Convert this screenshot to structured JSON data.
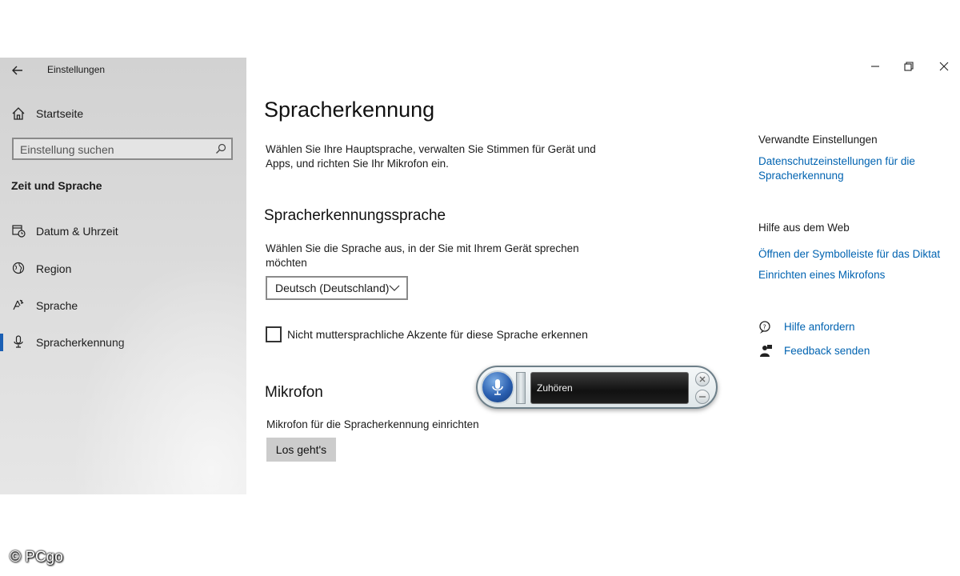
{
  "window": {
    "app_title": "Einstellungen"
  },
  "sidebar": {
    "home_label": "Startseite",
    "search_placeholder": "Einstellung suchen",
    "section_title": "Zeit und Sprache",
    "items": [
      {
        "label": "Datum & Uhrzeit",
        "icon": "calendar-clock-icon"
      },
      {
        "label": "Region",
        "icon": "globe-icon"
      },
      {
        "label": "Sprache",
        "icon": "language-icon"
      },
      {
        "label": "Spracherkennung",
        "icon": "microphone-icon",
        "active": true
      }
    ]
  },
  "main": {
    "page_title": "Spracherkennung",
    "intro": "Wählen Sie Ihre Hauptsprache, verwalten Sie Stimmen für Gerät und Apps, und richten Sie Ihr Mikrofon ein.",
    "language_section": {
      "title": "Spracherkennungssprache",
      "description": "Wählen Sie die Sprache aus, in der Sie mit Ihrem Gerät sprechen möchten",
      "selected_language": "Deutsch (Deutschland)",
      "accent_checkbox_label": "Nicht muttersprachliche Akzente für diese Sprache erkennen",
      "accent_checkbox_checked": false
    },
    "microphone_section": {
      "title": "Mikrofon",
      "description": "Mikrofon für die Spracherkennung einrichten",
      "button_label": "Los geht's"
    }
  },
  "related": {
    "title": "Verwandte Einstellungen",
    "privacy_link": "Datenschutzeinstellungen für die Spracherkennung",
    "web_help_title": "Hilfe aus dem Web",
    "dictation_link": "Öffnen der Symbolleiste für das Diktat",
    "mic_setup_link": "Einrichten eines Mikrofons",
    "get_help_link": "Hilfe anfordern",
    "feedback_link": "Feedback senden"
  },
  "speech_widget": {
    "status_text": "Zuhören"
  },
  "watermark": "© PCgo",
  "colors": {
    "link": "#0063b1",
    "accent": "#1a5fb4",
    "sidebar_bg": "#d6d6d6"
  }
}
